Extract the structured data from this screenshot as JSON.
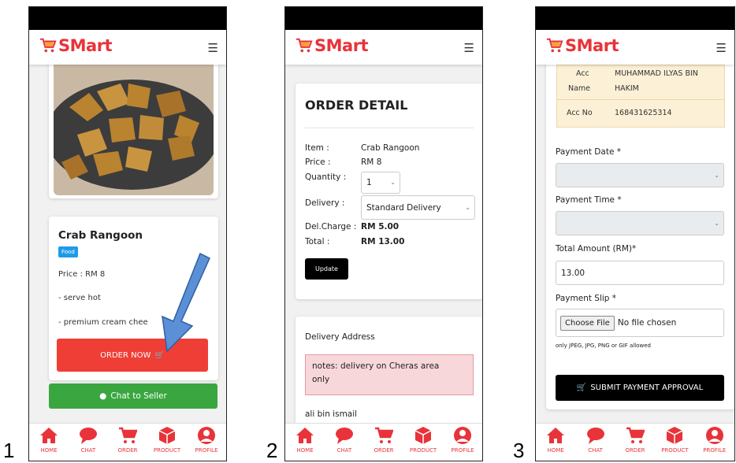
{
  "app": {
    "brand": "SMart",
    "accent": "#e8333a"
  },
  "step_numbers": [
    "1",
    "2",
    "3"
  ],
  "nav": [
    {
      "label": "HOME",
      "icon": "home-icon"
    },
    {
      "label": "CHAT",
      "icon": "chat-icon"
    },
    {
      "label": "ORDER",
      "icon": "cart-icon"
    },
    {
      "label": "PRODUCT",
      "icon": "box-icon"
    },
    {
      "label": "PROFILE",
      "icon": "profile-icon"
    }
  ],
  "screen1": {
    "product_name": "Crab Rangoon",
    "category_badge": "Food",
    "price": "Price : RM 8",
    "desc1": "- serve hot",
    "desc2": "- premium cream chee",
    "order_button": "ORDER NOW",
    "chat_button": "Chat to Seller"
  },
  "screen2": {
    "title": "ORDER DETAIL",
    "item_label": "Item :",
    "item_value": "Crab Rangoon",
    "price_label": "Price :",
    "price_value": "RM 8",
    "qty_label": "Quantity :",
    "qty_value": "1",
    "delivery_label": "Delivery :",
    "delivery_value": "Standard Delivery",
    "delcharge_label": "Del.Charge :",
    "delcharge_value": "RM 5.00",
    "total_label": "Total :",
    "total_value": "RM 13.00",
    "update_button": "Update",
    "address_title": "Delivery Address",
    "note_line1": "notes: delivery on Cheras area",
    "note_line2": "only",
    "recipient": "ali bin ismail"
  },
  "screen3": {
    "acc_label1": "Acc",
    "acc_label2": "Name",
    "acc_name1": "MUHAMMAD ILYAS BIN",
    "acc_name2": "HAKIM",
    "acc_no_label": "Acc No",
    "acc_no": "168431625314",
    "payment_date_label": "Payment Date *",
    "payment_time_label": "Payment Time *",
    "total_amount_label": "Total Amount (RM)*",
    "total_amount_value": "13.00",
    "slip_label": "Payment Slip *",
    "choose_file": "Choose File",
    "no_file": "No file chosen",
    "allowed_hint": "only JPEG, JPG, PNG or GIF allowed",
    "submit_button": "SUBMIT PAYMENT APPROVAL"
  }
}
